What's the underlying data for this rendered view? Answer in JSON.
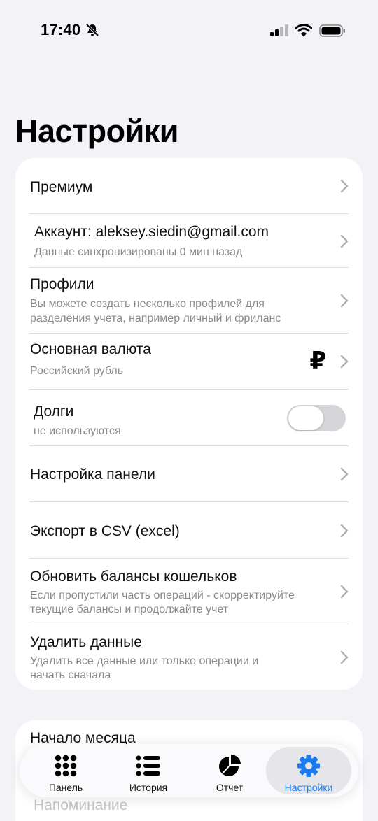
{
  "status_bar": {
    "time": "17:40"
  },
  "page_title": "Настройки",
  "settings": {
    "premium": {
      "title": "Премиум"
    },
    "account": {
      "title": "Аккаунт: aleksey.siedin@gmail.com",
      "subtitle": "Данные синхронизированы 0 мин назад"
    },
    "profiles": {
      "title": "Профили",
      "subtitle_line1": "Вы можете создать несколько профилей для",
      "subtitle_line2": "разделения учета, например личный и фриланс"
    },
    "currency": {
      "title": "Основная валюта",
      "subtitle": "Российский рубль",
      "symbol": "₽"
    },
    "debts": {
      "title": "Долги",
      "subtitle": "не используются",
      "enabled": false
    },
    "panel_settings": {
      "title": "Настройка панели"
    },
    "export": {
      "title": "Экспорт в CSV (excel)"
    },
    "refresh_balances": {
      "title": "Обновить балансы кошельков",
      "subtitle_line1": "Если пропустили часть операций - скорректируйте",
      "subtitle_line2": "текущие балансы и продолжайте учет"
    },
    "delete_data": {
      "title": "Удалить данные",
      "subtitle_line1": "Удалить все данные или только операции и",
      "subtitle_line2": "начать сначала"
    }
  },
  "second_card": {
    "month_start": "Начало месяца",
    "reminder": "Напоминание"
  },
  "tabbar": {
    "tabs": [
      {
        "label": "Панель",
        "icon": "grid-icon"
      },
      {
        "label": "История",
        "icon": "list-icon"
      },
      {
        "label": "Отчет",
        "icon": "pie-chart-icon"
      },
      {
        "label": "Настройки",
        "icon": "gear-icon"
      }
    ],
    "active_tab": "Настройки",
    "accent_color": "#1a7cf0"
  }
}
